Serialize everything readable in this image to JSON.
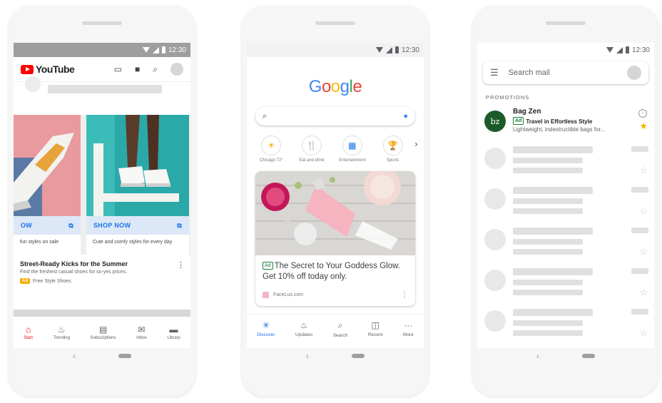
{
  "status": {
    "time": "12:30"
  },
  "youtube": {
    "logo_text": "YouTube",
    "cards": [
      {
        "button_label": "OW",
        "description": "fun styles on sale"
      },
      {
        "button_label": "SHOP NOW",
        "description": "Cute and comfy styles for every day"
      }
    ],
    "ad_title": "Street-Ready Kicks for the Summer",
    "ad_subtitle": "Find the freshest casual shoes for so-yes prices.",
    "ad_badge": "Ad",
    "ad_advertiser": "Free Style Shoes",
    "tabs": [
      {
        "label": "Start",
        "icon": "home-icon",
        "glyph": "⌂"
      },
      {
        "label": "Trending",
        "icon": "flame-icon",
        "glyph": "♨"
      },
      {
        "label": "Subscriptions",
        "icon": "subscriptions-icon",
        "glyph": "▤"
      },
      {
        "label": "Inbox",
        "icon": "inbox-icon",
        "glyph": "✉"
      },
      {
        "label": "Library",
        "icon": "folder-icon",
        "glyph": "▬"
      }
    ]
  },
  "google": {
    "logo_letters": [
      {
        "ch": "G",
        "color": "#4285F4"
      },
      {
        "ch": "o",
        "color": "#EA4335"
      },
      {
        "ch": "o",
        "color": "#FBBC05"
      },
      {
        "ch": "g",
        "color": "#4285F4"
      },
      {
        "ch": "l",
        "color": "#34A853"
      },
      {
        "ch": "e",
        "color": "#EA4335"
      }
    ],
    "shortcuts": [
      {
        "label": "Chicago 72°",
        "icon": "weather-icon",
        "glyph": "☀",
        "color": "#f9ab00"
      },
      {
        "label": "Eat and drink",
        "icon": "fork-knife-icon",
        "glyph": "🍴",
        "color": "#ea8600"
      },
      {
        "label": "Entertainment",
        "icon": "ticket-icon",
        "glyph": "▦",
        "color": "#1a73e8"
      },
      {
        "label": "Sports",
        "icon": "trophy-icon",
        "glyph": "🏆",
        "color": "#f9ab00"
      }
    ],
    "ad_badge": "Ad",
    "card_text": "The Secret to Your Goddess Glow. Get 10% off today only.",
    "card_source": "FaceLux.com",
    "tabs": [
      {
        "label": "Discover",
        "glyph": "✳",
        "icon": "discover-icon"
      },
      {
        "label": "Updates",
        "glyph": "♨",
        "icon": "updates-icon"
      },
      {
        "label": "Search",
        "glyph": "⌕",
        "icon": "search-icon"
      },
      {
        "label": "Recent",
        "glyph": "◫",
        "icon": "recent-icon"
      },
      {
        "label": "More",
        "glyph": "···",
        "icon": "more-icon"
      }
    ]
  },
  "gmail": {
    "search_placeholder": "Search mail",
    "section": "PROMOTIONS",
    "avatar_initials": "bz",
    "from": "Bag Zen",
    "ad_badge": "Ad",
    "subject": "Travel in Effortless Style",
    "snippet": "Lightweight, indestructible bags for...",
    "star_color": "#f4b400"
  },
  "nav": {
    "back": "‹"
  }
}
